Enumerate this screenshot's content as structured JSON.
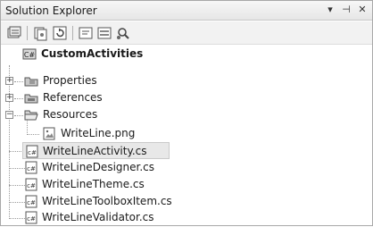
{
  "window": {
    "title": "Solution Explorer",
    "controls": {
      "pin": "▾",
      "autohide": "⊣",
      "close": "✕"
    }
  },
  "toolbar": {
    "buttons": [
      "properties-icon",
      "show-all-files-icon",
      "refresh-icon",
      "view-code-icon",
      "view-designer-icon",
      "class-view-icon"
    ]
  },
  "tree": {
    "project": "CustomActivities",
    "nodes": [
      {
        "label": "Properties",
        "icon": "folder-icon",
        "expander": "+"
      },
      {
        "label": "References",
        "icon": "references-icon",
        "expander": "+"
      },
      {
        "label": "Resources",
        "icon": "folder-open-icon",
        "expander": "−"
      },
      {
        "label": "WriteLine.png",
        "icon": "image-file-icon"
      },
      {
        "label": "WriteLineActivity.cs",
        "icon": "cs-file-icon",
        "selected": true
      },
      {
        "label": "WriteLineDesigner.cs",
        "icon": "cs-file-icon"
      },
      {
        "label": "WriteLineTheme.cs",
        "icon": "cs-file-icon"
      },
      {
        "label": "WriteLineToolboxItem.cs",
        "icon": "cs-file-icon"
      },
      {
        "label": "WriteLineValidator.cs",
        "icon": "cs-file-icon"
      }
    ]
  }
}
